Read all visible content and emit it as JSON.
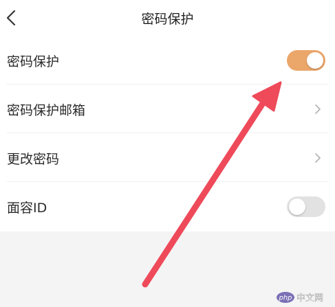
{
  "header": {
    "title": "密码保护",
    "back_icon": "chevron-left-icon"
  },
  "settings": {
    "password_protection": {
      "label": "密码保护",
      "toggle_on": true
    },
    "protection_email": {
      "label": "密码保护邮箱",
      "icon": "chevron-right-icon"
    },
    "change_password": {
      "label": "更改密码",
      "icon": "chevron-right-icon"
    },
    "face_id": {
      "label": "面容ID",
      "toggle_on": false
    }
  },
  "watermark": {
    "logo": "php中文网",
    "text": "php"
  },
  "colors": {
    "toggle_on": "#eba66a",
    "toggle_off": "#e2e2e2",
    "arrow": "#ee4a5a",
    "background": "#f4f4f4",
    "card": "#ffffff"
  }
}
